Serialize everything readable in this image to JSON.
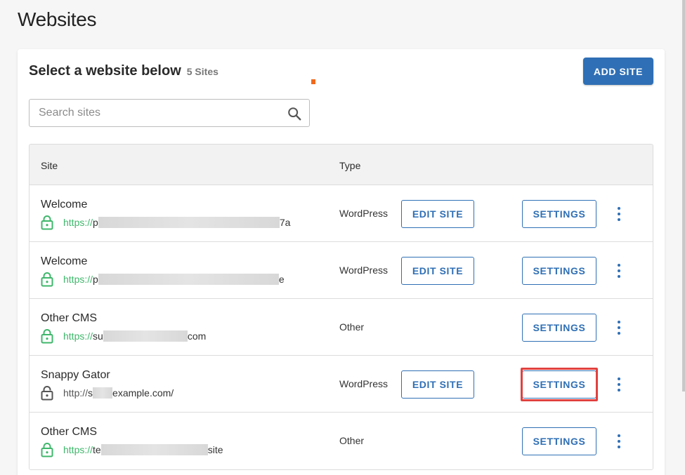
{
  "page": {
    "title": "Websites"
  },
  "card": {
    "title": "Select a website below",
    "count": "5 Sites",
    "add_button": "ADD SITE"
  },
  "search": {
    "placeholder": "Search sites",
    "value": ""
  },
  "table": {
    "headers": {
      "site": "Site",
      "type": "Type"
    },
    "rows": [
      {
        "name": "Welcome",
        "scheme": "https://",
        "url_pre": "p",
        "url_post": "7a",
        "type": "WordPress",
        "edit": "EDIT SITE",
        "settings": "SETTINGS"
      },
      {
        "name": "Welcome",
        "scheme": "https://",
        "url_pre": "p",
        "url_post": "e",
        "type": "WordPress",
        "edit": "EDIT SITE",
        "settings": "SETTINGS"
      },
      {
        "name": "Other CMS",
        "scheme": "https://",
        "url_pre": "su",
        "url_post": "com",
        "type": "Other",
        "settings": "SETTINGS"
      },
      {
        "name": "Snappy Gator",
        "scheme": "http://",
        "url_pre": "s",
        "url_post": "example.com/",
        "type": "WordPress",
        "edit": "EDIT SITE",
        "settings": "SETTINGS"
      },
      {
        "name": "Other CMS",
        "scheme": "https://",
        "url_pre": "te",
        "url_post": "site",
        "type": "Other",
        "settings": "SETTINGS"
      }
    ]
  },
  "colors": {
    "accent": "#2f6fb5",
    "secure": "#3fb76b",
    "highlight": "#e0413f"
  },
  "icons": {
    "search": "search-icon",
    "secure": "lock-closed-icon",
    "insecure": "lock-open-icon",
    "menu": "more-vertical-icon"
  }
}
